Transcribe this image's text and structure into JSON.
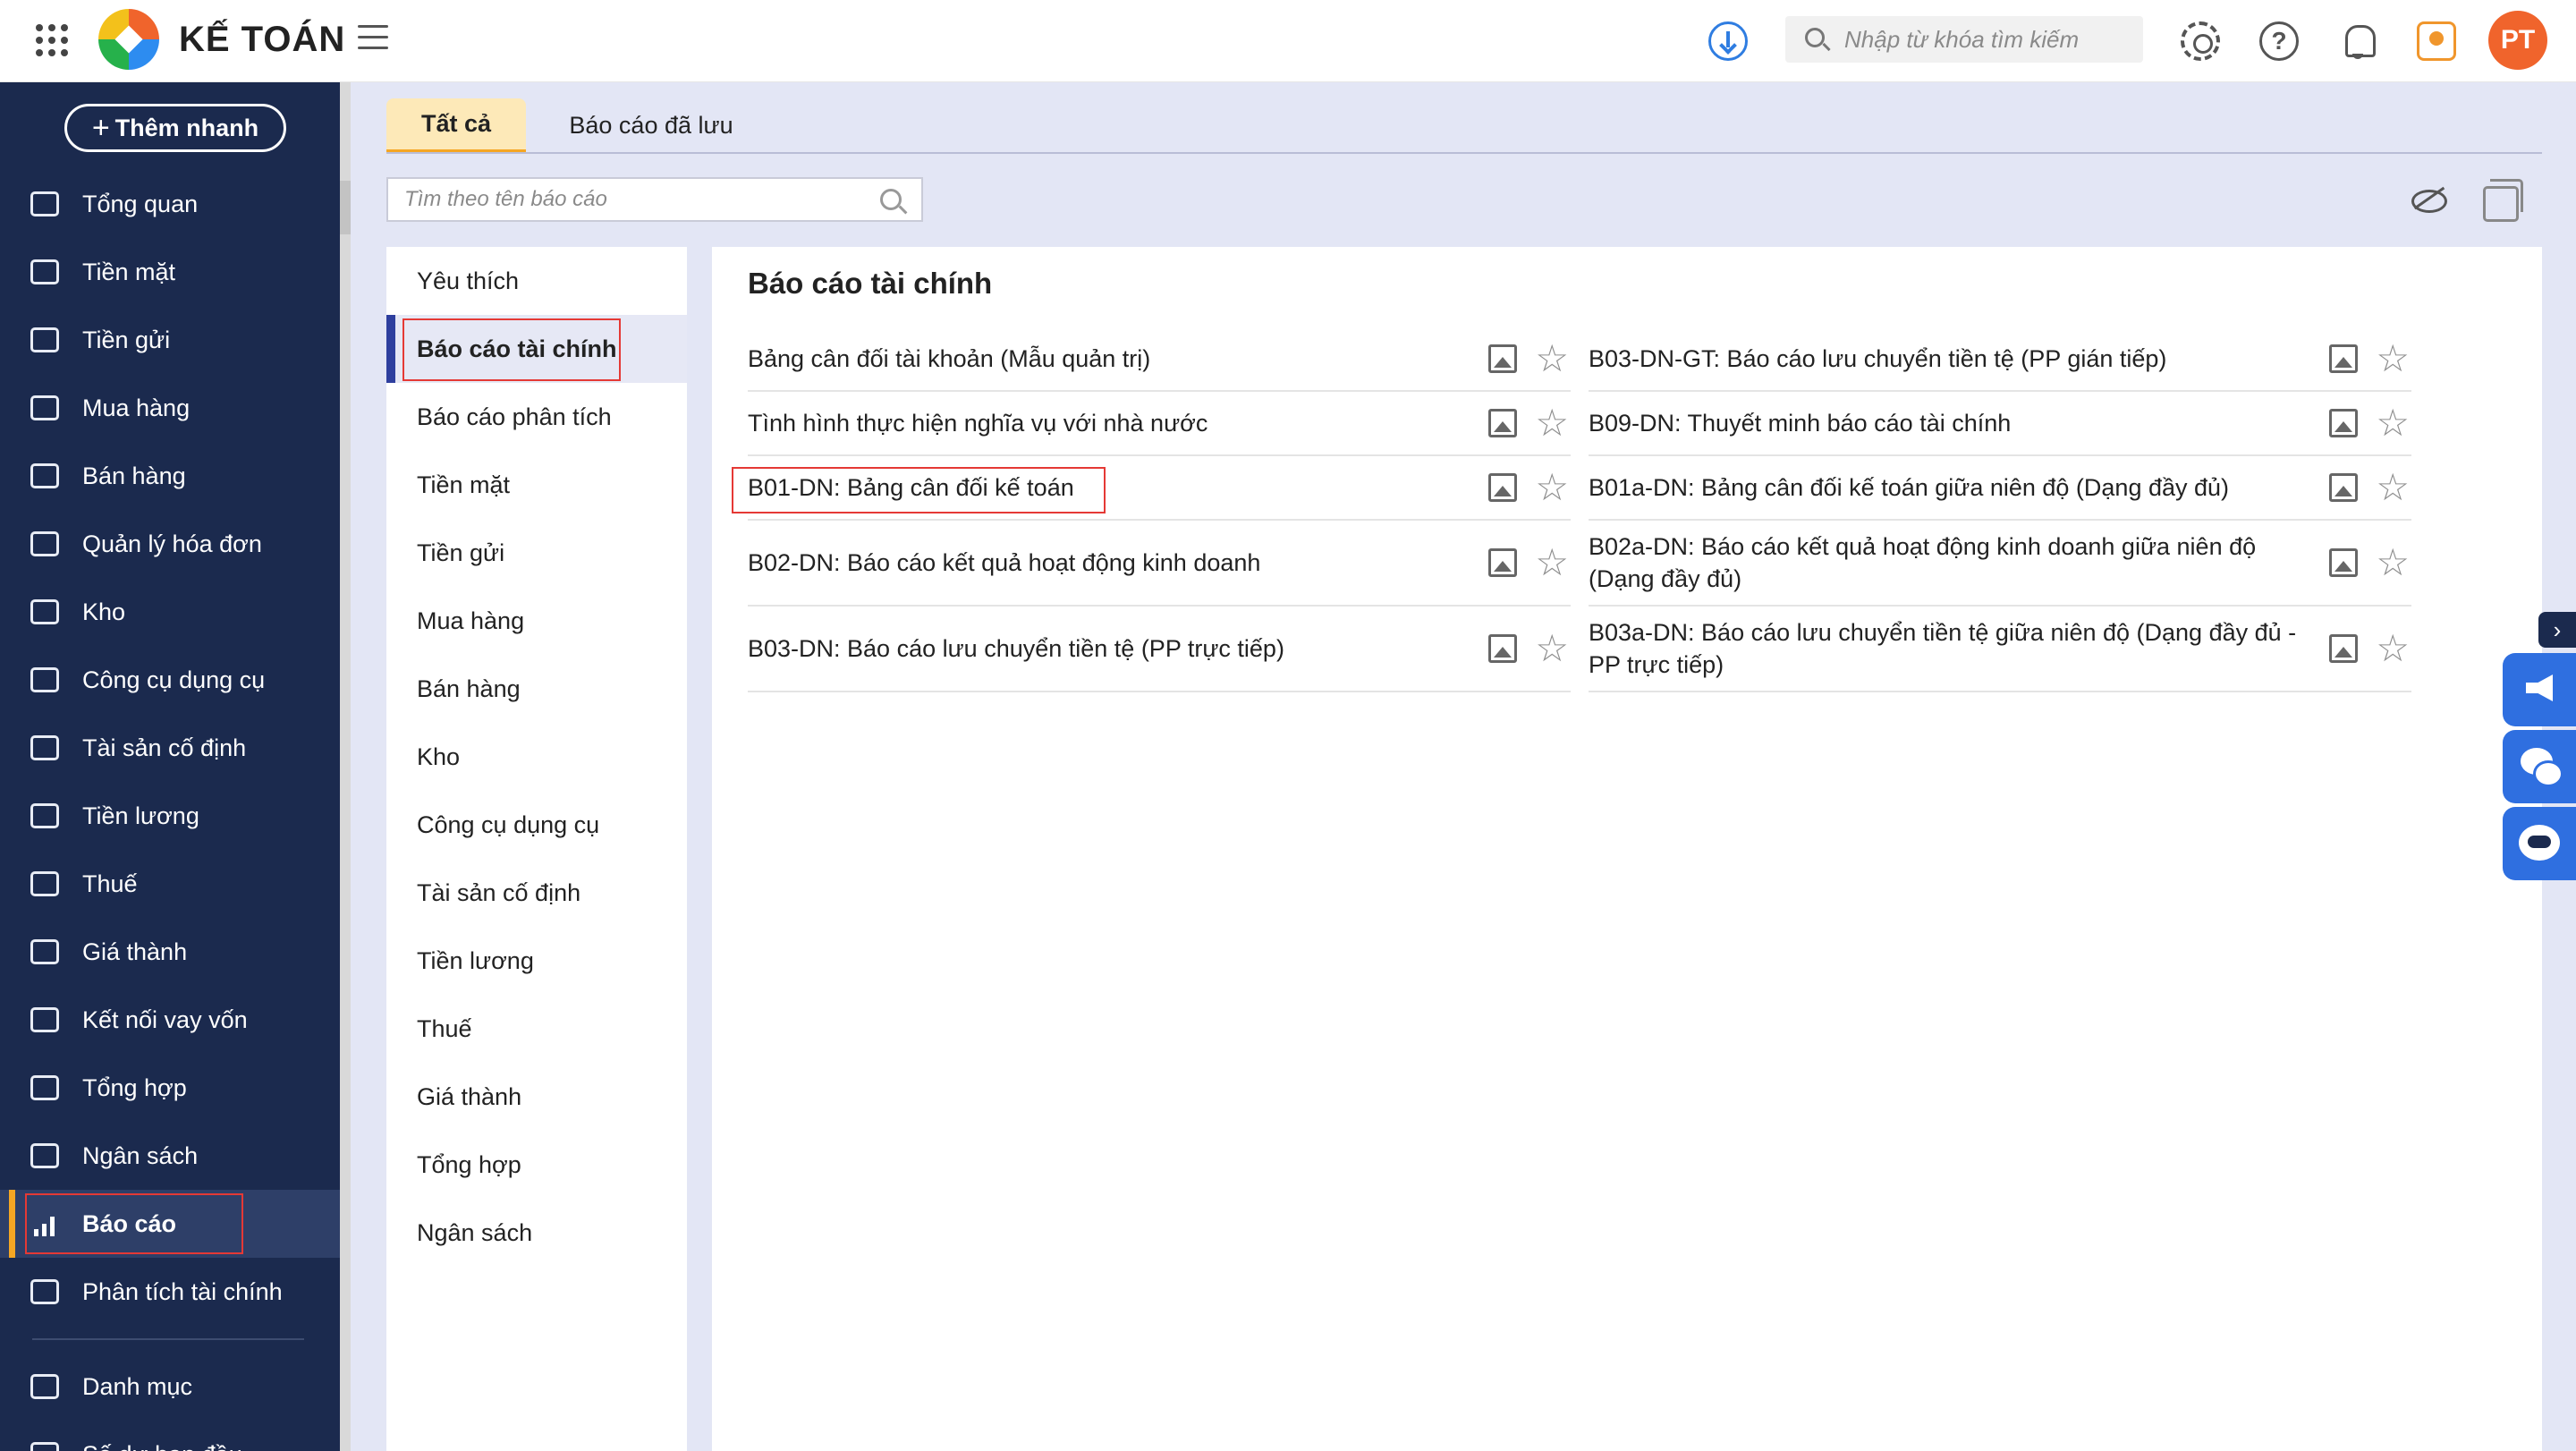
{
  "header": {
    "brand": "KẾ TOÁN",
    "search_placeholder": "Nhập từ khóa tìm kiếm",
    "avatar_initials": "PT"
  },
  "sidebar": {
    "quick_add_label": "Thêm nhanh",
    "items": [
      {
        "label": "Tổng quan",
        "icon": "dashboard-icon"
      },
      {
        "label": "Tiền mặt",
        "icon": "cash-icon"
      },
      {
        "label": "Tiền gửi",
        "icon": "bank-icon"
      },
      {
        "label": "Mua hàng",
        "icon": "shopping-bag-icon"
      },
      {
        "label": "Bán hàng",
        "icon": "cart-icon"
      },
      {
        "label": "Quản lý hóa đơn",
        "icon": "invoice-icon"
      },
      {
        "label": "Kho",
        "icon": "warehouse-icon"
      },
      {
        "label": "Công cụ dụng cụ",
        "icon": "tools-icon"
      },
      {
        "label": "Tài sản cố định",
        "icon": "asset-icon"
      },
      {
        "label": "Tiền lương",
        "icon": "salary-icon"
      },
      {
        "label": "Thuế",
        "icon": "tax-icon"
      },
      {
        "label": "Giá thành",
        "icon": "price-tag-icon"
      },
      {
        "label": "Kết nối vay vốn",
        "icon": "loan-icon"
      },
      {
        "label": "Tổng hợp",
        "icon": "summary-icon"
      },
      {
        "label": "Ngân sách",
        "icon": "budget-icon"
      },
      {
        "label": "Báo cáo",
        "icon": "bar-chart-icon",
        "active": true
      },
      {
        "label": "Phân tích tài chính",
        "icon": "line-chart-icon"
      }
    ],
    "bottom_items": [
      {
        "label": "Danh mục",
        "icon": "list-icon"
      },
      {
        "label": "Số dư ban đầu",
        "icon": "opening-balance-icon"
      }
    ]
  },
  "tabs": {
    "all": "Tất cả",
    "saved": "Báo cáo đã lưu"
  },
  "report_search": {
    "placeholder": "Tìm theo tên báo cáo"
  },
  "categories": [
    "Yêu thích",
    "Báo cáo tài chính",
    "Báo cáo phân tích",
    "Tiền mặt",
    "Tiền gửi",
    "Mua hàng",
    "Bán hàng",
    "Kho",
    "Công cụ dụng cụ",
    "Tài sản cố định",
    "Tiền lương",
    "Thuế",
    "Giá thành",
    "Tổng hợp",
    "Ngân sách"
  ],
  "active_category": "Báo cáo tài chính",
  "report_panel": {
    "title": "Báo cáo tài chính",
    "left": [
      "Bảng cân đối tài khoản (Mẫu quản trị)",
      "Tình hình thực hiện nghĩa vụ với nhà nước",
      "B01-DN: Bảng cân đối kế toán",
      "B02-DN: Báo cáo kết quả hoạt động kinh doanh",
      "B03-DN: Báo cáo lưu chuyển tiền tệ (PP trực tiếp)"
    ],
    "right": [
      "B03-DN-GT: Báo cáo lưu chuyển tiền tệ (PP gián tiếp)",
      "B09-DN: Thuyết minh báo cáo tài chính",
      "B01a-DN: Bảng cân đối kế toán giữa niên độ (Dạng đầy đủ)",
      "B02a-DN: Báo cáo kết quả hoạt động kinh doanh giữa niên độ (Dạng đầy đủ)",
      "B03a-DN: Báo cáo lưu chuyển tiền tệ giữa niên độ (Dạng đầy đủ - PP trực tiếp)"
    ]
  },
  "float_toolbar": {
    "arrow": "›"
  }
}
